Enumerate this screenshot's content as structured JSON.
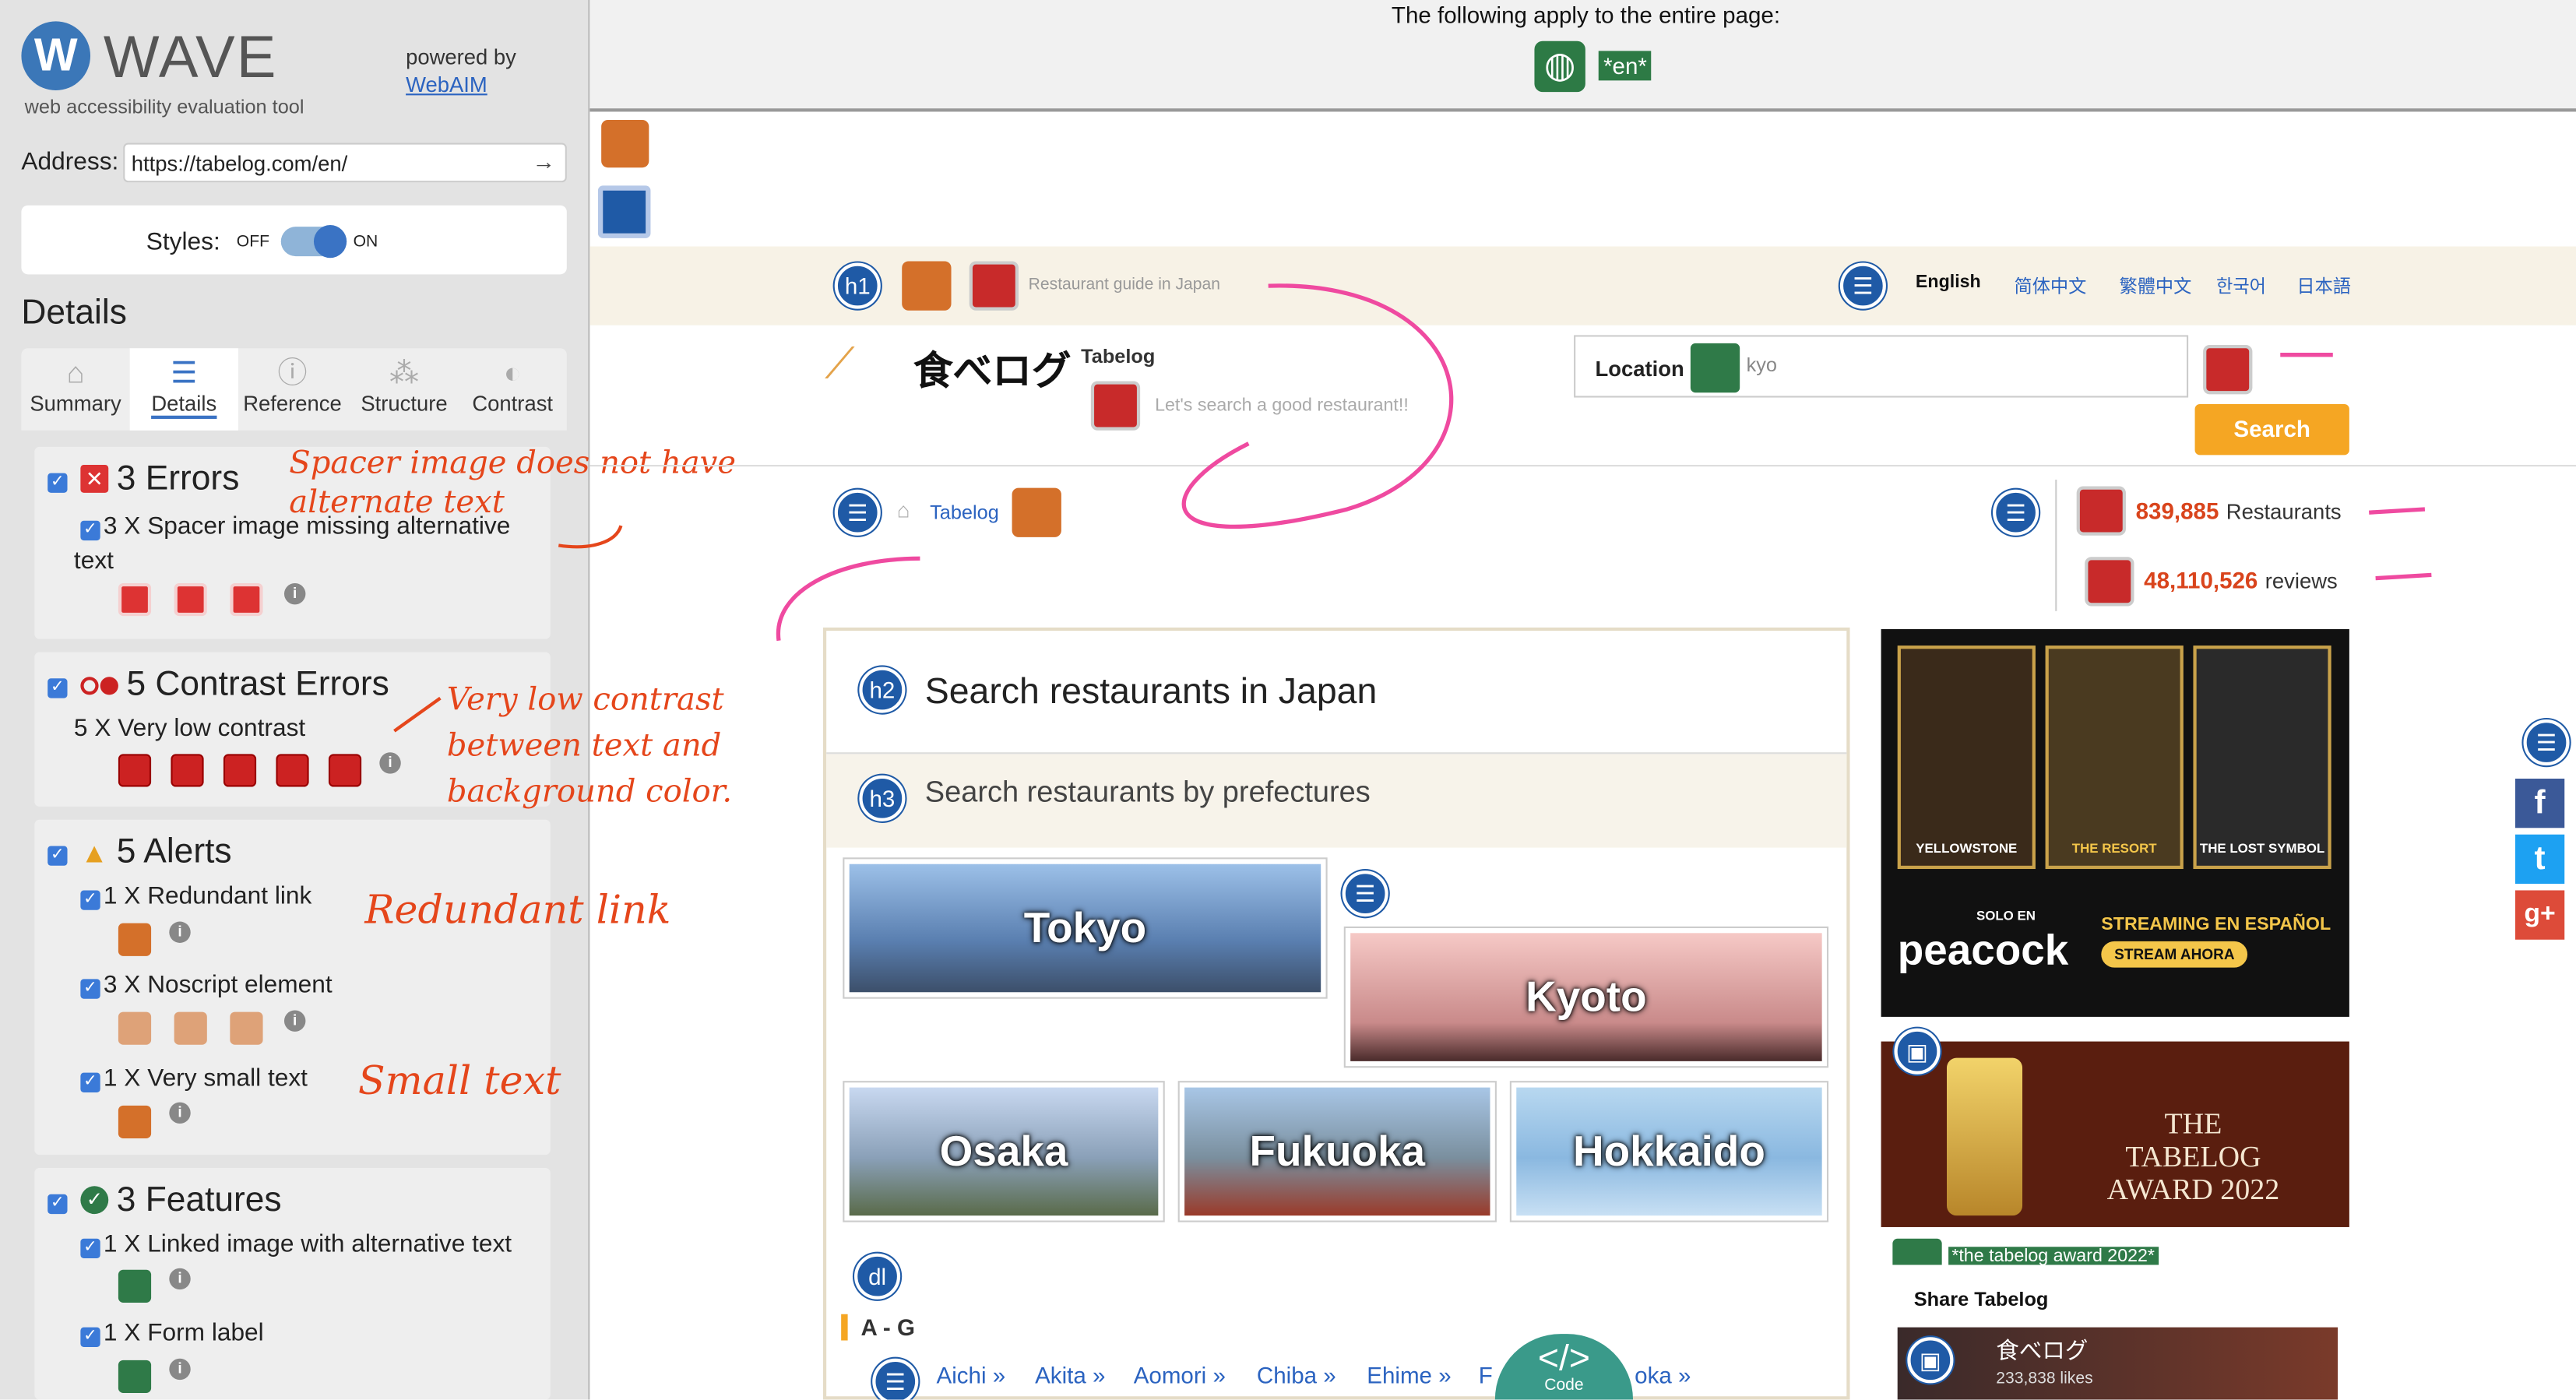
{
  "sidebar": {
    "logo_mark": "W",
    "logo_text": "WAVE",
    "logo_sub": "web accessibility evaluation tool",
    "powered_by": "powered by",
    "webaim": "WebAIM",
    "address_label": "Address:",
    "address_value": "https://tabelog.com/en/",
    "styles_label": "Styles:",
    "styles_off": "OFF",
    "styles_on": "ON",
    "details_heading": "Details",
    "tabs": [
      {
        "label": "Summary",
        "icon": "home-icon"
      },
      {
        "label": "Details",
        "icon": "list-icon"
      },
      {
        "label": "Reference",
        "icon": "info-icon"
      },
      {
        "label": "Structure",
        "icon": "structure-icon"
      },
      {
        "label": "Contrast",
        "icon": "contrast-icon"
      }
    ],
    "errors": {
      "heading": "3 Errors",
      "item": "3 X Spacer image missing alternative text"
    },
    "contrast": {
      "heading": "5 Contrast Errors",
      "item": "5 X Very low contrast"
    },
    "alerts": {
      "heading": "5 Alerts",
      "items": [
        "1 X Redundant link",
        "3 X Noscript element",
        "1 X Very small text"
      ]
    },
    "features": {
      "heading": "3 Features",
      "items": [
        "1 X Linked image with alternative text",
        "1 X Form label"
      ]
    }
  },
  "annotations": {
    "spacer": "Spacer image does not have alternate text",
    "contrast": "Very low contrast between text and background color.",
    "redundant": "Redundant link",
    "small": "Small text"
  },
  "page": {
    "apply_text": "The following apply to the entire page:",
    "lang_tag": "*en*",
    "tagline": "Restaurant guide in Japan",
    "languages": [
      "English",
      "简体中文",
      "繁體中文",
      "한국어",
      "日本語"
    ],
    "brand_jp": "食べログ",
    "brand_en": "Tabelog",
    "slogan": "Let's search a good restaurant!!",
    "location_label": "Location",
    "search_placeholder": "kyo",
    "search_button": "Search",
    "breadcrumb": "Tabelog",
    "restaurants_count": "839,885",
    "restaurants_label": "Restaurants",
    "reviews_count": "48,110,526",
    "reviews_label": "reviews",
    "h2": "Search restaurants in Japan",
    "h3": "Search restaurants by prefectures",
    "cities": [
      "Tokyo",
      "Kyoto",
      "Osaka",
      "Fukuoka",
      "Hokkaido"
    ],
    "ag": "A - G",
    "prefectures": [
      "Aichi »",
      "Akita »",
      "Aomori »",
      "Chiba »",
      "Ehime »",
      "F",
      "oka »"
    ],
    "code_label": "Code",
    "code_glyph": "</>",
    "ad1_brands": [
      "YELLOWSTONE",
      "THE RESORT",
      "THE LOST SYMBOL"
    ],
    "ad1_cta": "STREAMING EN ESPAÑOL",
    "ad1_cta2": "STREAM AHORA",
    "ad1_peacock": "peacock",
    "ad1_solo": "SOLO EN",
    "ad2_text": "THE TABELOG AWARD 2022",
    "award_tag": "*the tabelog award 2022*",
    "share": "Share Tabelog",
    "fb_name": "食べログ",
    "fb_likes": "233,838 likes"
  }
}
